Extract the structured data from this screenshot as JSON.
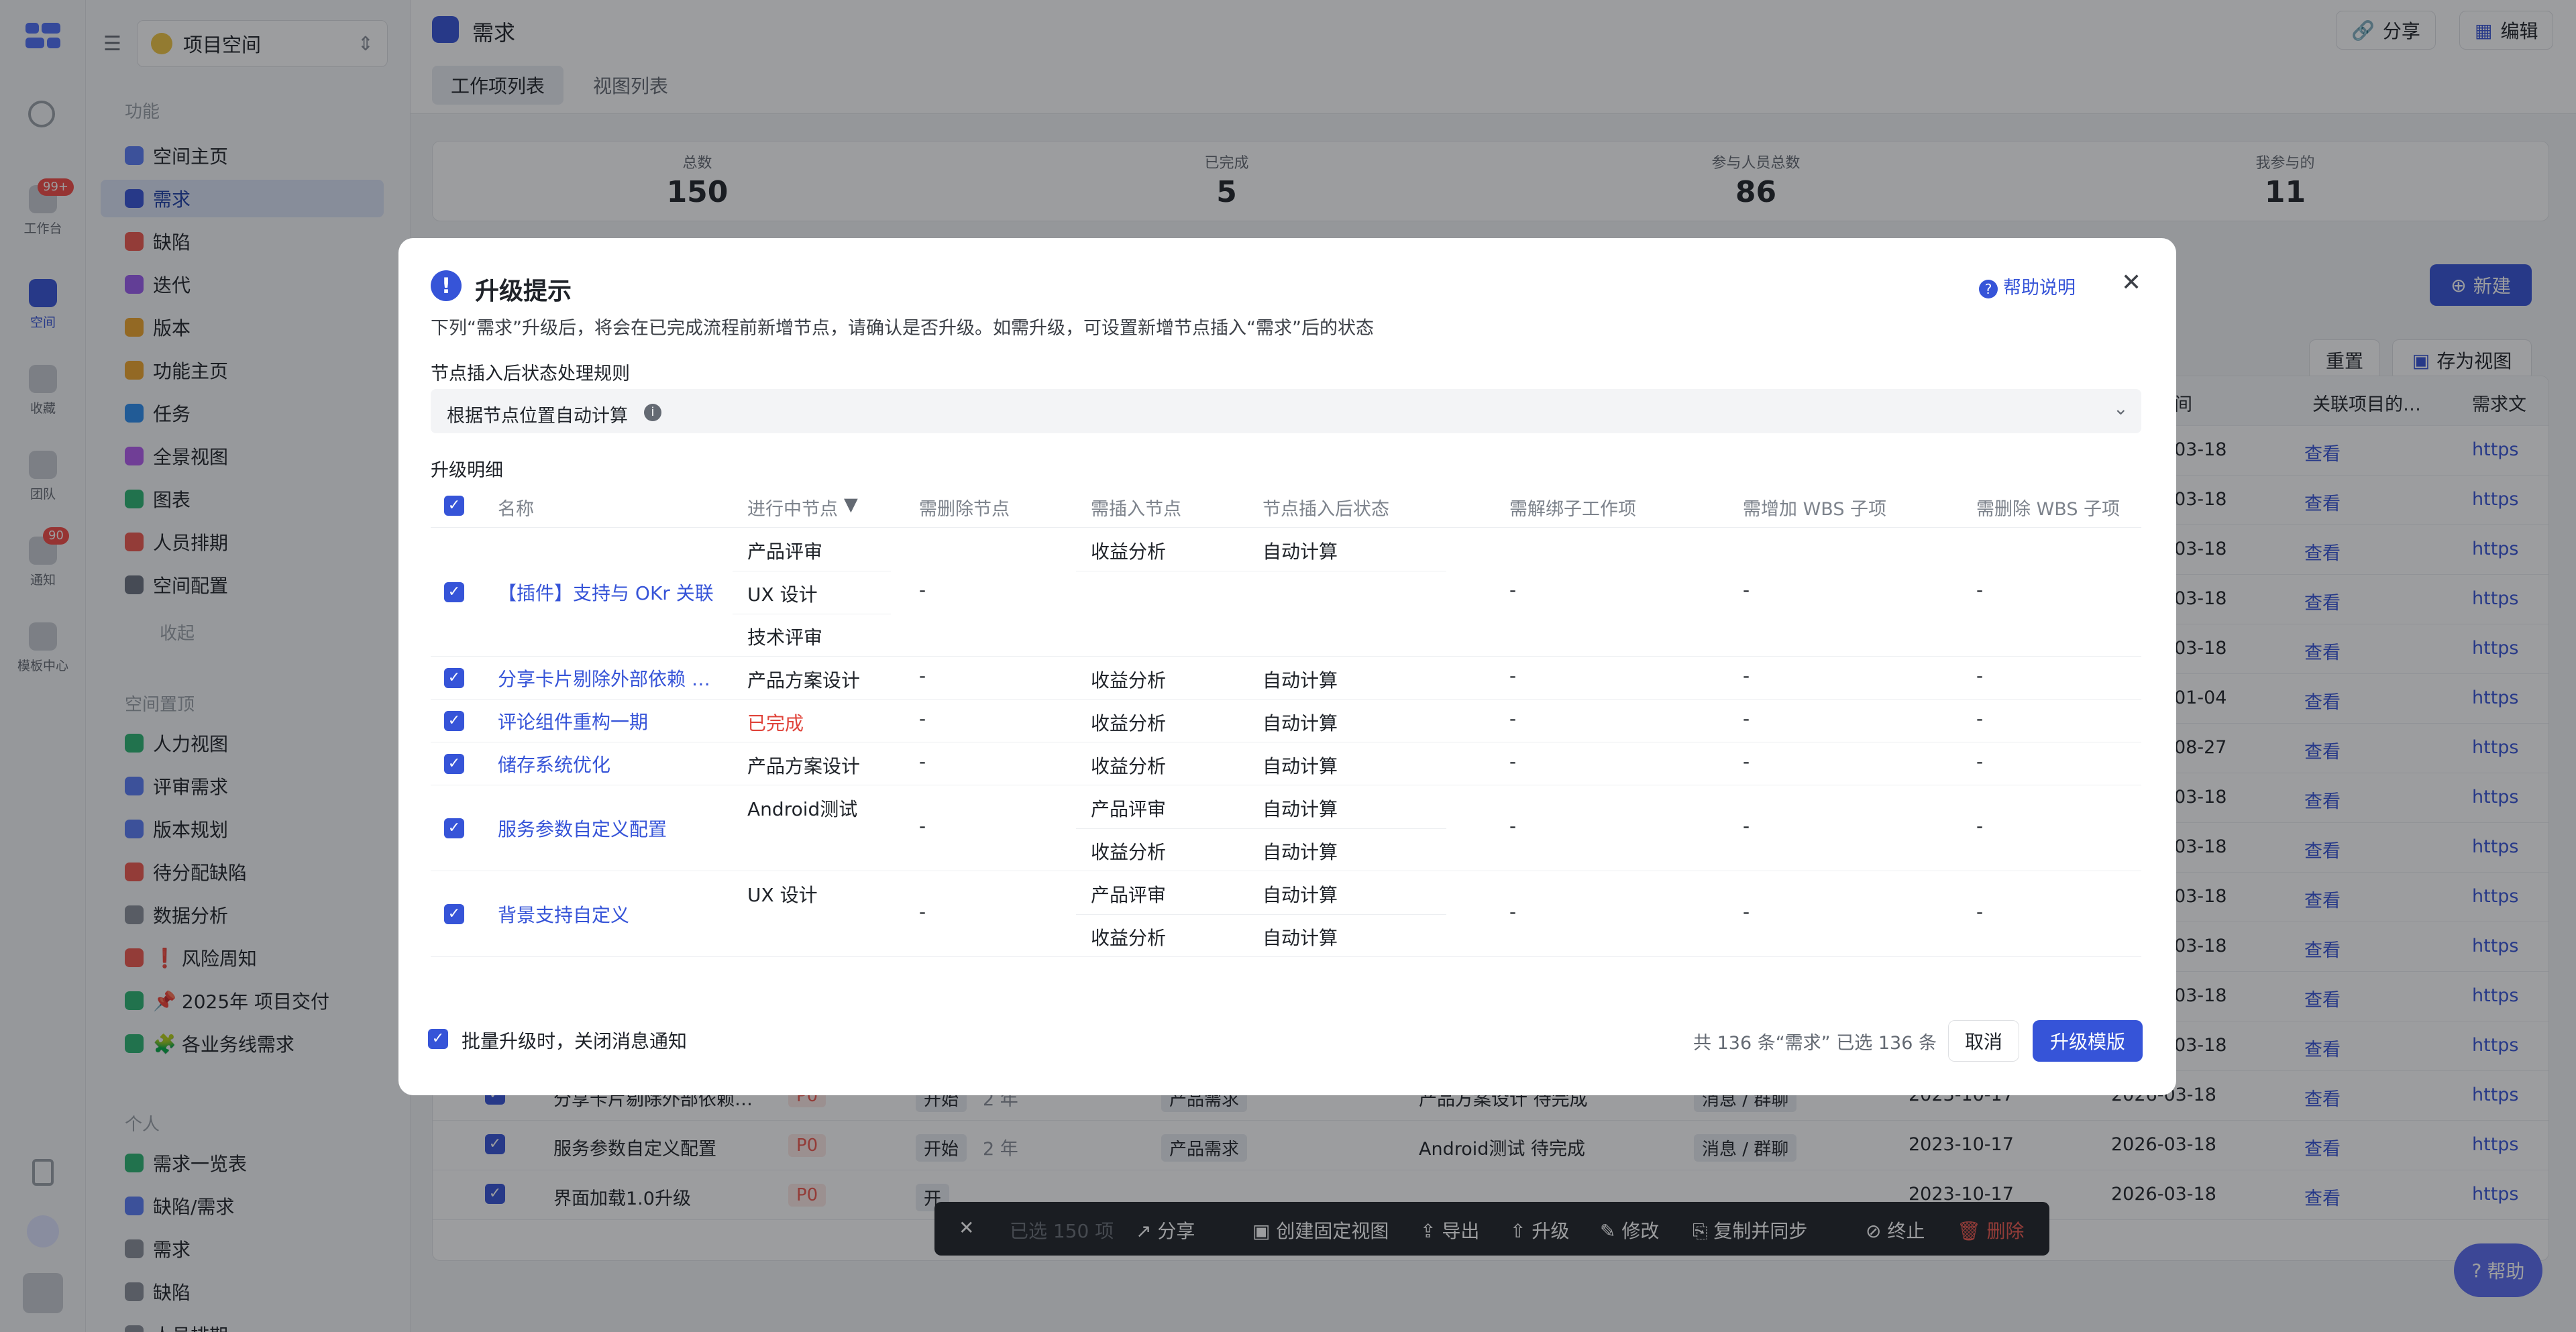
{
  "rail": {
    "items": [
      {
        "label": "工作台",
        "badge": "99+"
      },
      {
        "label": "空间"
      },
      {
        "label": "收藏"
      },
      {
        "label": "团队"
      },
      {
        "label": "通知",
        "badge": "90"
      },
      {
        "label": "模板中心"
      }
    ]
  },
  "sidebar": {
    "workspace": "项目空间",
    "section_func": "功能",
    "items": [
      {
        "label": "空间主页",
        "color": "#5b7cf6"
      },
      {
        "label": "需求",
        "color": "#3654d8"
      },
      {
        "label": "缺陷",
        "color": "#f0594f"
      },
      {
        "label": "迭代",
        "color": "#9b5cf0"
      },
      {
        "label": "版本",
        "color": "#f0a52b"
      },
      {
        "label": "功能主页",
        "color": "#f0a52b"
      },
      {
        "label": "任务",
        "color": "#2b8ef0"
      },
      {
        "label": "全景视图",
        "color": "#b45cf0"
      },
      {
        "label": "图表",
        "color": "#2bb673"
      },
      {
        "label": "人员排期",
        "color": "#f0594f"
      },
      {
        "label": "空间配置",
        "color": "#6b7280"
      }
    ],
    "collapse": "收起",
    "section_pin": "空间置顶",
    "pinned": [
      {
        "label": "人力视图",
        "color": "#2bb673"
      },
      {
        "label": "评审需求",
        "color": "#5b7cf6"
      },
      {
        "label": "版本规划",
        "color": "#5b7cf6"
      },
      {
        "label": "待分配缺陷",
        "color": "#f0594f"
      },
      {
        "label": "数据分析",
        "color": "#8a9099"
      },
      {
        "label": "风险周知",
        "color": "#f0594f",
        "prefix": "❗"
      },
      {
        "label": "2025年 项目交付",
        "color": "#2bb673",
        "prefix": "📌"
      },
      {
        "label": "各业务线需求",
        "color": "#2bb673",
        "prefix": "🧩"
      }
    ],
    "section_personal": "个人",
    "personal": [
      {
        "label": "需求一览表",
        "color": "#2bb673"
      },
      {
        "label": "缺陷/需求",
        "color": "#5b7cf6"
      },
      {
        "label": "需求",
        "color": "#8a9099"
      },
      {
        "label": "缺陷",
        "color": "#8a9099"
      },
      {
        "label": "人员排期",
        "color": "#8a9099"
      }
    ]
  },
  "header": {
    "title": "需求",
    "tabs": [
      "工作项列表",
      "视图列表"
    ],
    "share": "分享",
    "edit": "编辑"
  },
  "stats": [
    {
      "label": "总数",
      "value": "150"
    },
    {
      "label": "已完成",
      "value": "5"
    },
    {
      "label": "参与人员总数",
      "value": "86"
    },
    {
      "label": "我参与的",
      "value": "11"
    }
  ],
  "toolbar": {
    "new": "新建",
    "reset": "重置",
    "save_view": "存为视图"
  },
  "bg_columns": [
    "间",
    "关联项目的…",
    "需求文"
  ],
  "bg_right_dates": [
    "03-18",
    "03-18",
    "03-18",
    "03-18",
    "03-18",
    "01-04",
    "08-27",
    "03-18",
    "03-18",
    "03-18",
    "03-18",
    "03-18",
    "03-18"
  ],
  "bg_view": "查看",
  "bg_link": "https",
  "bg_rows": [
    {
      "name": "分享卡片剔除外部依赖…",
      "pri": "P0",
      "status": "开始",
      "age": "2 年",
      "type": "产品需求",
      "node": "产品方案设计 待完成",
      "chan": "消息 / 群聊",
      "start": "2023-10-17",
      "end": "2026-03-18"
    },
    {
      "name": "服务参数自定义配置",
      "pri": "P0",
      "status": "开始",
      "age": "2 年",
      "type": "产品需求",
      "node": "Android测试 待完成",
      "chan": "消息 / 群聊",
      "start": "2023-10-17",
      "end": "2026-03-18"
    },
    {
      "name": "界面加载1.0升级",
      "pri": "P0",
      "status": "开",
      "age": "",
      "type": "",
      "node": "",
      "chan": "",
      "start": "2023-10-17",
      "end": "2026-03-18"
    }
  ],
  "batch_bar": {
    "selected": "已选 150 项",
    "share": "分享",
    "create_view": "创建固定视图",
    "export": "导出",
    "upgrade": "升级",
    "modify": "修改",
    "copy_sync": "复制并同步",
    "terminate": "终止",
    "delete": "删除"
  },
  "help_fab": "帮助",
  "dialog": {
    "title": "升级提示",
    "help": "帮助说明",
    "desc": "下列“需求”升级后，将会在已完成流程前新增节点，请确认是否升级。如需升级，可设置新增节点插入“需求”后的状态",
    "rule_label": "节点插入后状态处理规则",
    "rule_value": "根据节点位置自动计算",
    "detail_label": "升级明细",
    "columns": [
      "名称",
      "进行中节点",
      "需删除节点",
      "需插入节点",
      "节点插入后状态",
      "需解绑子工作项",
      "需增加 WBS 子项",
      "需删除 WBS 子项"
    ],
    "rows": [
      {
        "name": "【插件】支持与 OKr 关联",
        "nodes": [
          "产品评审",
          "UX 设计",
          "技术评审"
        ],
        "del": "-",
        "ins": [
          "收益分析"
        ],
        "state": [
          "自动计算"
        ],
        "unbind": "-",
        "add_wbs": "-",
        "del_wbs": "-"
      },
      {
        "name": "分享卡片剔除外部依赖 …",
        "nodes": [
          "产品方案设计"
        ],
        "del": "-",
        "ins": [
          "收益分析"
        ],
        "state": [
          "自动计算"
        ],
        "unbind": "-",
        "add_wbs": "-",
        "del_wbs": "-"
      },
      {
        "name": "评论组件重构一期",
        "nodes": [
          "已完成"
        ],
        "done": true,
        "del": "-",
        "ins": [
          "收益分析"
        ],
        "state": [
          "自动计算"
        ],
        "unbind": "-",
        "add_wbs": "-",
        "del_wbs": "-"
      },
      {
        "name": "储存系统优化",
        "nodes": [
          "产品方案设计"
        ],
        "del": "-",
        "ins": [
          "收益分析"
        ],
        "state": [
          "自动计算"
        ],
        "unbind": "-",
        "add_wbs": "-",
        "del_wbs": "-"
      },
      {
        "name": "服务参数自定义配置",
        "nodes": [
          "Android测试"
        ],
        "del": "-",
        "ins": [
          "产品评审",
          "收益分析"
        ],
        "state": [
          "自动计算",
          "自动计算"
        ],
        "unbind": "-",
        "add_wbs": "-",
        "del_wbs": "-"
      },
      {
        "name": "背景支持自定义",
        "nodes": [
          "UX 设计"
        ],
        "del": "-",
        "ins": [
          "产品评审",
          "收益分析"
        ],
        "state": [
          "自动计算",
          "自动计算"
        ],
        "unbind": "-",
        "add_wbs": "-",
        "del_wbs": "-"
      }
    ],
    "notify_label": "批量升级时，关闭消息通知",
    "summary": "共 136 条“需求” 已选 136 条",
    "cancel": "取消",
    "confirm": "升级模版"
  }
}
